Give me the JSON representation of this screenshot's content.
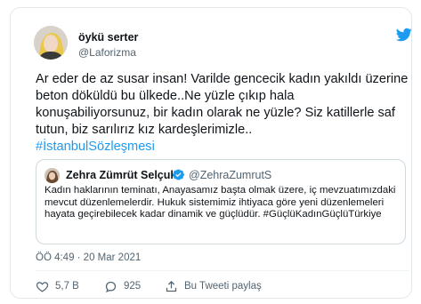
{
  "author": {
    "name": "öykü serter",
    "handle": "@Laforizma"
  },
  "tweet": {
    "text": "Ar eder de az susar insan! Varilde gencecik kadın yakıldı üzerine beton döküldü bu ülkede..Ne yüzle çıkıp hala konuşabiliyorsunuz, bir kadın olarak ne yüzle? Siz katillerle saf tutun, biz sarılırız kız kardeşlerimizle..",
    "hashtag": "#İstanbulSözleşmesi"
  },
  "quoted": {
    "name": "Zehra Zümrüt Selçuk",
    "handle": "@ZehraZumrutS",
    "text": "Kadın haklarının teminatı, Anayasamız başta olmak üzere, iç mevzuatımızdaki mevcut düzenlemelerdir. Hukuk sistemimiz ihtiyaca göre yeni düzenlemeleri hayata geçirebilecek kadar dinamik ve güçlüdür. #GüçlüKadınGüçlüTürkiye"
  },
  "meta": {
    "timestamp": "ÖÖ 4:49 · 20 Mar 2021"
  },
  "actions": {
    "likes": "5,7 B",
    "replies": "925",
    "share_label": "Bu Tweeti paylaş"
  },
  "colors": {
    "accent": "#1d9bf0",
    "like_red": "#e0245e",
    "text": "#0f1419",
    "secondary": "#536471"
  },
  "icons": {
    "brand": "twitter-bird-icon",
    "verified": "verified-badge-icon",
    "like": "heart-icon",
    "reply": "reply-icon",
    "share": "share-icon"
  }
}
